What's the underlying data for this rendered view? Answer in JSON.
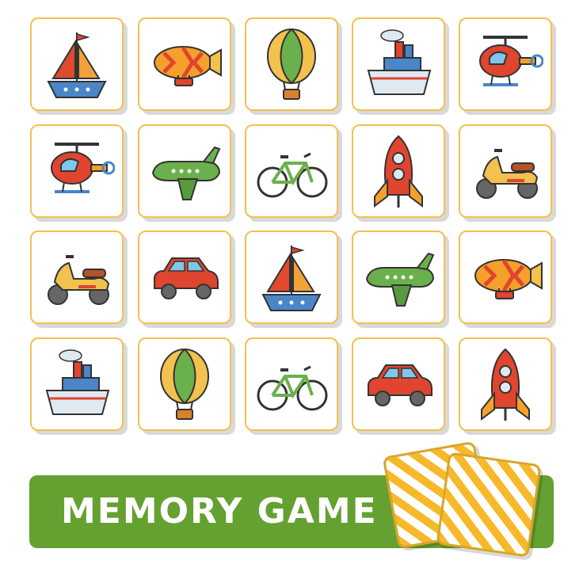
{
  "game": {
    "title": "MEMORY GAME",
    "colors": {
      "banner": "#64a130",
      "card_border": "#f2c14e",
      "card_back_stripe": "#f7b92a"
    },
    "grid": {
      "rows": 4,
      "columns": 5,
      "cards": [
        [
          "sailboat-icon",
          "airship-icon",
          "hot-air-balloon-icon",
          "steamship-icon",
          "helicopter-icon"
        ],
        [
          "helicopter-icon",
          "airplane-icon",
          "bicycle-icon",
          "rocket-icon",
          "scooter-icon"
        ],
        [
          "scooter-icon",
          "car-icon",
          "sailboat-icon",
          "airplane-icon",
          "airship-icon"
        ],
        [
          "steamship-icon",
          "hot-air-balloon-icon",
          "bicycle-icon",
          "car-icon",
          "rocket-icon"
        ]
      ]
    },
    "deck": {
      "cards_face_down": 2
    }
  }
}
